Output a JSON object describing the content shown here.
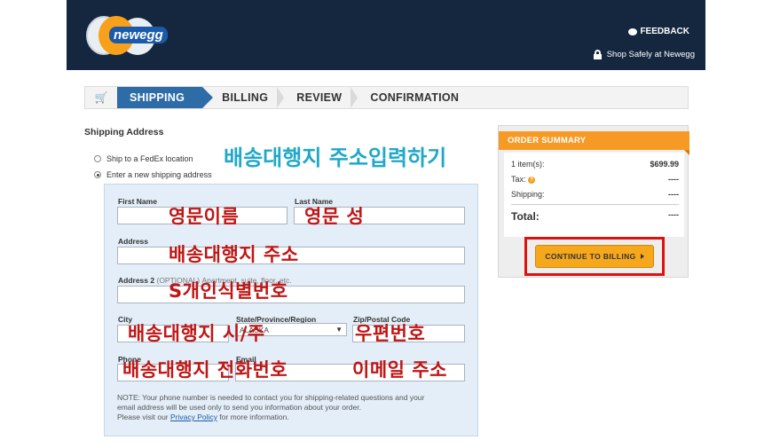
{
  "header": {
    "logo_text": "newegg",
    "feedback_label": "FEEDBACK",
    "shop_safely_label": "Shop Safely at Newegg"
  },
  "steps": [
    {
      "label": "SHIPPING",
      "active": true
    },
    {
      "label": "BILLING",
      "active": false
    },
    {
      "label": "REVIEW",
      "active": false
    },
    {
      "label": "CONFIRMATION",
      "active": false
    }
  ],
  "shipping": {
    "title": "Shipping Address",
    "option_fedex": "Ship to a FedEx location",
    "option_new": "Enter a new shipping address",
    "selected_option": "Enter a new shipping address",
    "fields": {
      "first_name_label": "First Name",
      "last_name_label": "Last Name",
      "address_label": "Address",
      "address2_label": "Address 2",
      "address2_optional": "(OPTIONAL)",
      "address2_placeholder": "Apartment, suite, floor, etc.",
      "city_label": "City",
      "state_label": "State/Province/Region",
      "state_value": "ALASKA",
      "zip_label": "Zip/Postal Code",
      "phone_label": "Phone",
      "email_label": "Email"
    },
    "note_line1": "NOTE: Your phone number is needed to contact you for shipping-related questions and your",
    "note_line2": "email address will be used only to send you information about your order.",
    "note_line3_pre": "Please visit our",
    "privacy_link": "Privacy Policy",
    "note_line3_post": "for more information."
  },
  "annotations": {
    "heading": "배송대행지 주소입력하기",
    "first_name": "영문이름",
    "last_name": "영문 성",
    "address": "배송대행지 주소",
    "address2": "S개인식별번호",
    "city_state": "배송대행지 시/주",
    "zip": "우편번호",
    "phone": "배송대행지 전화번호",
    "email": "이메일 주소"
  },
  "summary": {
    "title": "ORDER SUMMARY",
    "items_label": "1 item(s):",
    "items_value": "$699.99",
    "tax_label": "Tax:",
    "tax_value": "----",
    "shipping_label": "Shipping:",
    "shipping_value": "----",
    "total_label": "Total:",
    "total_value": "----",
    "cta_label": "CONTINUE TO BILLING"
  },
  "colors": {
    "header_bg": "#14273f",
    "active_step": "#2e6ca8",
    "summary_orange": "#f79a25",
    "annotation_red": "#c01515",
    "annotation_blue": "#20a8c8",
    "highlight_frame": "#e20f0f"
  }
}
